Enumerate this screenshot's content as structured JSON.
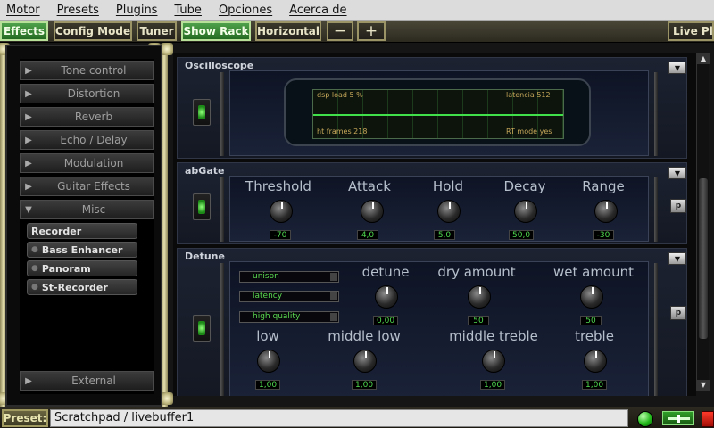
{
  "menubar": {
    "items": [
      "Motor",
      "Presets",
      "Plugins",
      "Tube",
      "Opciones",
      "Acerca de"
    ]
  },
  "toolbar": {
    "effects": "Effects",
    "config_mode": "Config Mode",
    "tuner": "Tuner",
    "show_rack": "Show Rack",
    "horizontal": "Horizontal",
    "minus": "−",
    "plus": "+",
    "live_play": "Live Pla"
  },
  "categories": {
    "tone_control": "Tone control",
    "distortion": "Distortion",
    "reverb": "Reverb",
    "echo_delay": "Echo / Delay",
    "modulation": "Modulation",
    "guitar_effects": "Guitar Effects",
    "misc": "Misc",
    "external": "External"
  },
  "misc_plugins": [
    "Recorder",
    "Bass Enhancer",
    "Panoram",
    "St-Recorder"
  ],
  "oscilloscope": {
    "title": "Oscilloscope",
    "dsp_load": "dsp load  5 %",
    "latencia": "latencia    512",
    "ht_frames": "ht frames 218",
    "rt_mode": "RT mode  yes"
  },
  "abgate": {
    "title": "abGate",
    "knobs": [
      {
        "label": "Threshold",
        "value": "-70"
      },
      {
        "label": "Attack",
        "value": "4,0"
      },
      {
        "label": "Hold",
        "value": "5,0"
      },
      {
        "label": "Decay",
        "value": "50,0"
      },
      {
        "label": "Range",
        "value": "-30"
      }
    ]
  },
  "detune": {
    "title": "Detune",
    "combos": [
      "unison",
      "latency",
      "high quality"
    ],
    "knobs_top": [
      {
        "label": "detune",
        "value": "0,00"
      },
      {
        "label": "dry amount",
        "value": "50"
      },
      {
        "label": "wet amount",
        "value": "50"
      }
    ],
    "knobs_bottom": [
      {
        "label": "low",
        "value": "1,00"
      },
      {
        "label": "middle low",
        "value": "1,00"
      },
      {
        "label": "middle treble",
        "value": "1,00"
      },
      {
        "label": "treble",
        "value": "1,00"
      }
    ]
  },
  "statusbar": {
    "preset_label": "Preset:",
    "preset_value": "Scratchpad / livebuffer1"
  },
  "icons": {
    "category_arrow": "▶",
    "category_arrow_open": "▼",
    "unit_menu": "▼",
    "preset_btn": "p"
  }
}
